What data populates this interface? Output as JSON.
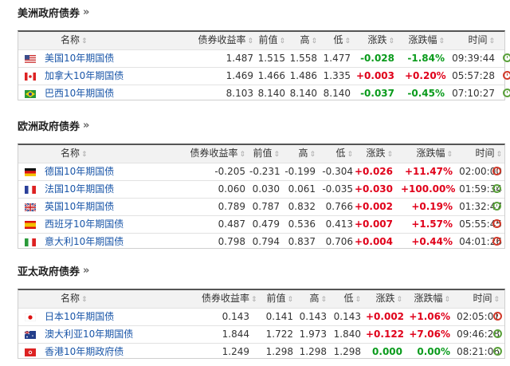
{
  "headers": {
    "name": "名称",
    "yield": "债券收益率",
    "prev": "前值",
    "high": "高",
    "low": "低",
    "change": "涨跌",
    "change_pct": "涨跌幅",
    "time": "时间"
  },
  "sections": [
    {
      "title": "美洲政府债券",
      "rows": [
        {
          "flag": "us",
          "name": "美国10年期国债",
          "yield": "1.487",
          "prev": "1.515",
          "high": "1.558",
          "low": "1.477",
          "change": "-0.028",
          "change_pct": "-1.84%",
          "time": "09:39:44",
          "dir": "neg",
          "clock": "green"
        },
        {
          "flag": "ca",
          "name": "加拿大10年期国债",
          "yield": "1.469",
          "prev": "1.466",
          "high": "1.486",
          "low": "1.335",
          "change": "+0.003",
          "change_pct": "+0.20%",
          "time": "05:57:28",
          "dir": "pos",
          "clock": "red"
        },
        {
          "flag": "br",
          "name": "巴西10年期国债",
          "yield": "8.103",
          "prev": "8.140",
          "high": "8.140",
          "low": "8.140",
          "change": "-0.037",
          "change_pct": "-0.45%",
          "time": "07:10:27",
          "dir": "neg",
          "clock": "green"
        }
      ]
    },
    {
      "title": "欧洲政府债券",
      "rows": [
        {
          "flag": "de",
          "name": "德国10年期国债",
          "yield": "-0.205",
          "prev": "-0.231",
          "high": "-0.199",
          "low": "-0.304",
          "change": "+0.026",
          "change_pct": "+11.47%",
          "time": "02:00:00",
          "dir": "pos",
          "clock": "red"
        },
        {
          "flag": "fr",
          "name": "法国10年期国债",
          "yield": "0.060",
          "prev": "0.030",
          "high": "0.061",
          "low": "-0.035",
          "change": "+0.030",
          "change_pct": "+100.00%",
          "time": "01:59:34",
          "dir": "pos",
          "clock": "green"
        },
        {
          "flag": "gb",
          "name": "英国10年期国债",
          "yield": "0.789",
          "prev": "0.787",
          "high": "0.832",
          "low": "0.766",
          "change": "+0.002",
          "change_pct": "+0.19%",
          "time": "01:32:47",
          "dir": "pos",
          "clock": "green"
        },
        {
          "flag": "es",
          "name": "西班牙10年期国债",
          "yield": "0.487",
          "prev": "0.479",
          "high": "0.536",
          "low": "0.413",
          "change": "+0.007",
          "change_pct": "+1.57%",
          "time": "05:55:45",
          "dir": "pos",
          "clock": "red"
        },
        {
          "flag": "it",
          "name": "意大利10年期国债",
          "yield": "0.798",
          "prev": "0.794",
          "high": "0.837",
          "low": "0.706",
          "change": "+0.004",
          "change_pct": "+0.44%",
          "time": "04:01:26",
          "dir": "pos",
          "clock": "red"
        }
      ]
    },
    {
      "title": "亚太政府债券",
      "rows": [
        {
          "flag": "jp",
          "name": "日本10年期国债",
          "yield": "0.143",
          "prev": "0.141",
          "high": "0.143",
          "low": "0.143",
          "change": "+0.002",
          "change_pct": "+1.06%",
          "time": "02:05:01",
          "dir": "pos",
          "clock": "red"
        },
        {
          "flag": "au",
          "name": "澳大利亚10年期国债",
          "yield": "1.844",
          "prev": "1.722",
          "high": "1.973",
          "low": "1.840",
          "change": "+0.122",
          "change_pct": "+7.06%",
          "time": "09:46:28",
          "dir": "pos",
          "clock": "green"
        },
        {
          "flag": "hk",
          "name": "香港10年期政府债",
          "yield": "1.249",
          "prev": "1.298",
          "high": "1.298",
          "low": "1.298",
          "change": "0.000",
          "change_pct": "0.00%",
          "time": "08:21:06",
          "dir": "neg",
          "clock": "green"
        }
      ]
    }
  ]
}
